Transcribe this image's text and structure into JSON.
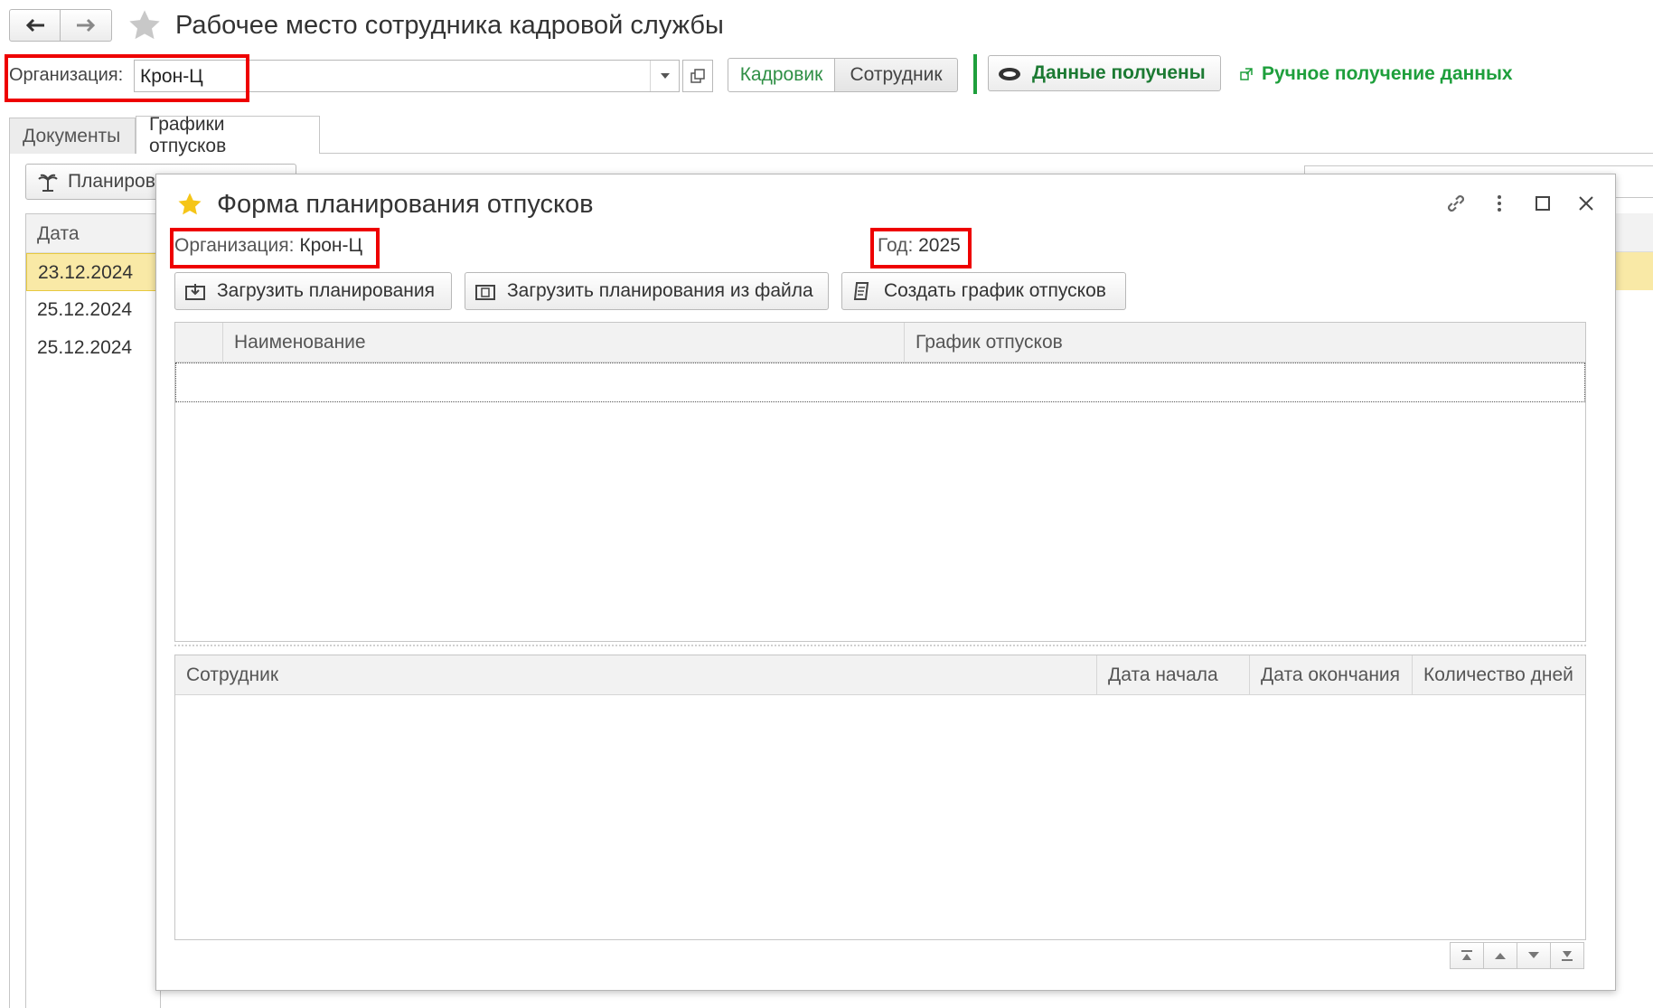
{
  "window": {
    "title": "Рабочее место сотрудника кадровой службы",
    "nav_back": "back-arrow-icon",
    "nav_forward": "forward-arrow-icon",
    "favorite_icon": "star-icon"
  },
  "org_field": {
    "label": "Организация:",
    "value": "Крон-Ц"
  },
  "mode_toggle": {
    "hr": "Кадровик",
    "employee": "Сотрудник"
  },
  "data_button": {
    "label": "Данные получены"
  },
  "manual_link": {
    "label": "Ручное получение данных"
  },
  "tabs": [
    {
      "label": "Документы",
      "active": false
    },
    {
      "label": "Графики отпусков",
      "active": true
    }
  ],
  "background": {
    "plan_button": "Планирова",
    "table": {
      "header": "Дата",
      "rows": [
        "23.12.2024",
        "25.12.2024",
        "25.12.2024"
      ]
    }
  },
  "modal": {
    "title": "Форма планирования отпусков",
    "org_label": "Организация:",
    "org_value": "Крон-Ц",
    "year_label": "Год:",
    "year_value": "2025",
    "buttons": [
      {
        "label": "Загрузить планирования"
      },
      {
        "label": "Загрузить планирования из файла"
      },
      {
        "label": "Создать график отпусков"
      }
    ],
    "top_grid": {
      "columns": [
        "Наименование",
        "График отпусков"
      ]
    },
    "bottom_grid": {
      "columns": [
        "Сотрудник",
        "Дата начала",
        "Дата окончания",
        "Количество дней"
      ]
    }
  },
  "colors": {
    "accent_green": "#1e9f3c",
    "highlight_red": "#ee0000",
    "selection_yellow": "#f9e9a6"
  }
}
